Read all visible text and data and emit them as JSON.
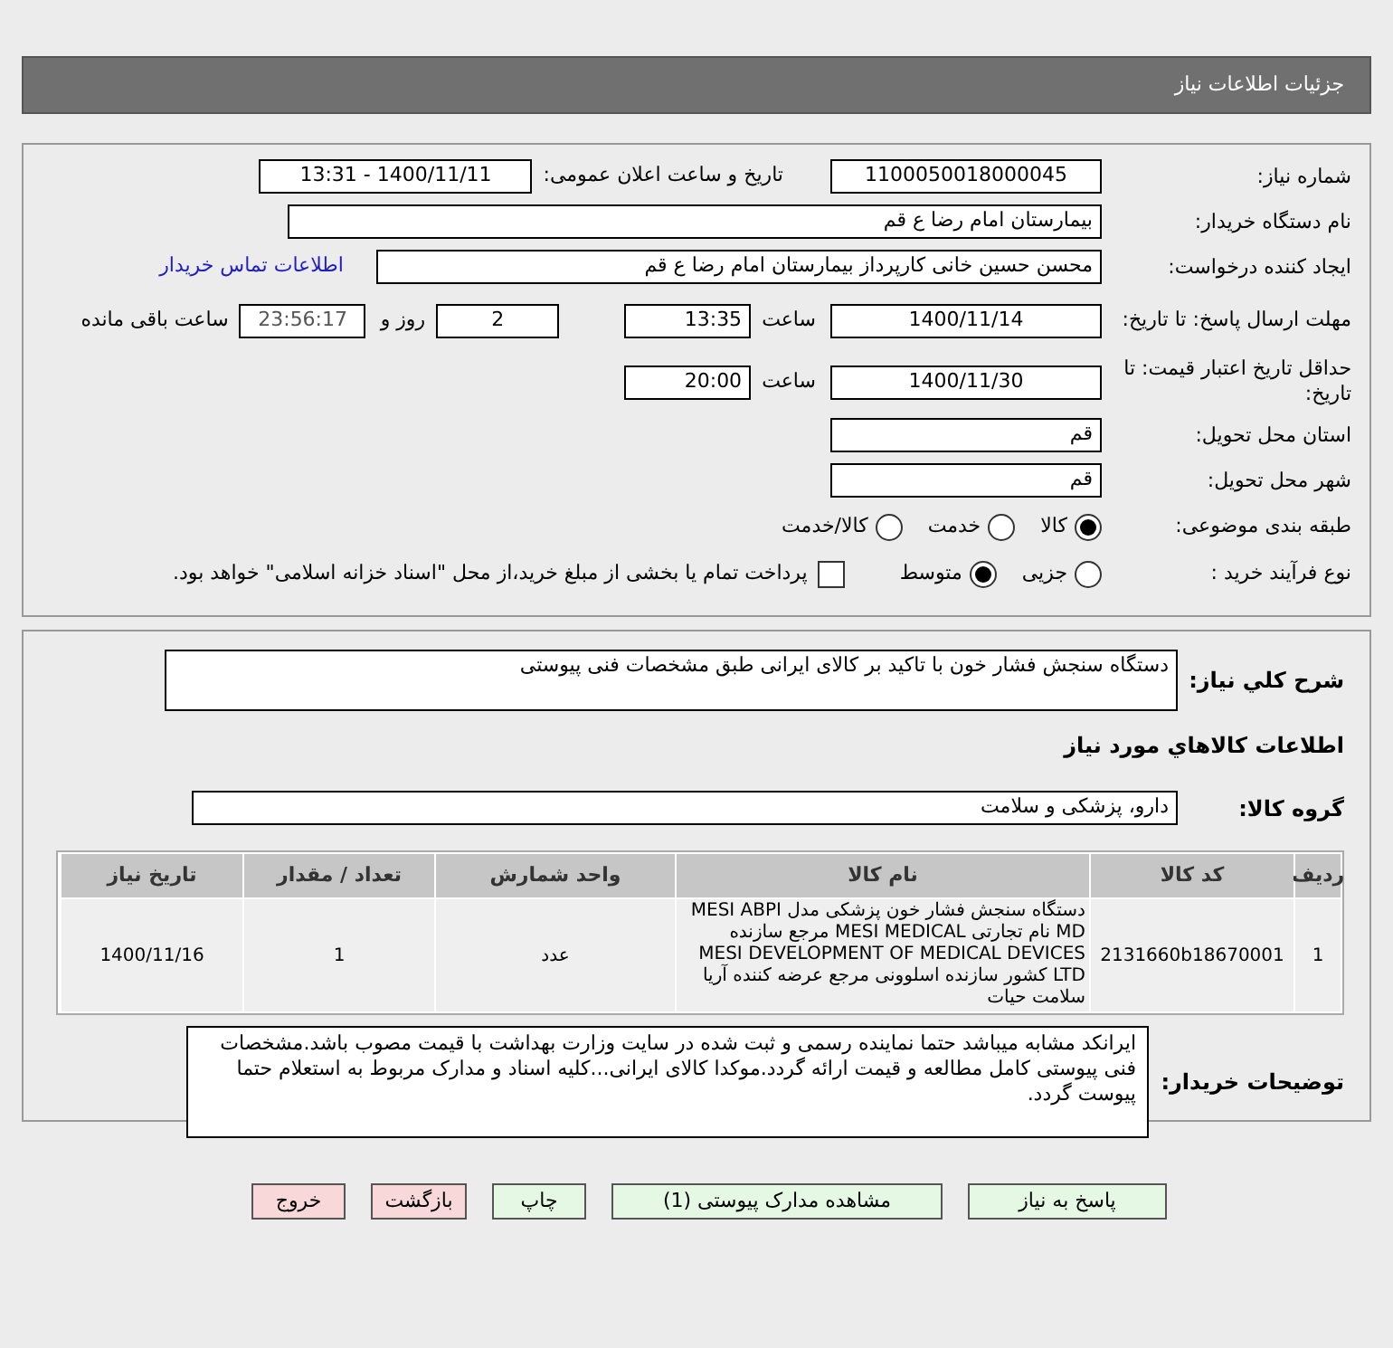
{
  "header": {
    "title": "جزئیات اطلاعات نیاز"
  },
  "details": {
    "need_number": {
      "label": "شماره نیاز:",
      "value": "1100050018000045"
    },
    "announce": {
      "label": "تاریخ و ساعت اعلان عمومی:",
      "value": "1400/11/11 - 13:31"
    },
    "buyer_org": {
      "label": "نام دستگاه خریدار:",
      "value": "بیمارستان امام رضا ع  قم"
    },
    "requester": {
      "label": "ایجاد کننده درخواست:",
      "value": "محسن حسین خانی کارپرداز بیمارستان امام رضا ع  قم",
      "link": "اطلاعات تماس خریدار"
    },
    "reply_deadline": {
      "label": "مهلت ارسال پاسخ: تا تاریخ:",
      "date": "1400/11/14",
      "time_label": "ساعت",
      "time": "13:35",
      "days": "2",
      "days_label": "روز و",
      "remaining": "23:56:17",
      "remaining_label": "ساعت باقی مانده"
    },
    "price_validity": {
      "label": "حداقل تاریخ اعتبار قیمت: تا تاریخ:",
      "date": "1400/11/30",
      "time_label": "ساعت",
      "time": "20:00"
    },
    "province": {
      "label": "استان محل تحویل:",
      "value": "قم"
    },
    "city": {
      "label": "شهر محل تحویل:",
      "value": "قم"
    },
    "category": {
      "label": "طبقه بندی موضوعی:",
      "options": [
        {
          "label": "کالا",
          "selected": true
        },
        {
          "label": "خدمت",
          "selected": false
        },
        {
          "label": "کالا/خدمت",
          "selected": false
        }
      ]
    },
    "process": {
      "label": "نوع فرآیند خرید :",
      "options": [
        {
          "label": "جزیی",
          "selected": false
        },
        {
          "label": "متوسط",
          "selected": true
        }
      ],
      "payment": {
        "label": "پرداخت تمام یا بخشی از مبلغ خرید،از محل \"اسناد خزانه اسلامی\" خواهد بود.",
        "checked": false
      }
    }
  },
  "goods": {
    "description": {
      "label": "شرح کلي نياز:",
      "value": "دستگاه سنجش فشار خون با تاکید بر کالای ایرانی طبق مشخصات فنی پیوستی"
    },
    "section_title": "اطلاعات کالاهاي مورد نياز",
    "group": {
      "label": "گروه کالا:",
      "value": "دارو، پزشکی و سلامت"
    },
    "table": {
      "columns": [
        "ردیف",
        "کد کالا",
        "نام کالا",
        "واحد شمارش",
        "تعداد / مقدار",
        "تاریخ نیاز"
      ],
      "rows": [
        [
          "1",
          "2131660b18670001",
          "دستگاه سنجش فشار خون پزشکی مدل MESI ABPI MD نام تجارتی MESI MEDICAL مرجع سازنده MESI DEVELOPMENT OF MEDICAL DEVICES LTD کشور سازنده اسلوونی مرجع عرضه کننده آریا سلامت حیات",
          "عدد",
          "1",
          "1400/11/16"
        ]
      ]
    },
    "notes": {
      "label": "توضیحات خریدار:",
      "value": "ایرانکد مشابه میباشد حتما نماینده رسمی و ثبت شده در سایت وزارت بهداشت با قیمت مصوب باشد.مشخصات فنی پیوستی کامل مطالعه و قیمت ارائه گردد.موکدا کالای ایرانی...کلیه اسناد و مدارک مربوط به استعلام حتما پیوست گردد."
    }
  },
  "buttons": [
    {
      "label": "پاسخ به نیاز",
      "kind": "normal"
    },
    {
      "label": "مشاهده مدارک پیوستی (1)",
      "kind": "normal"
    },
    {
      "label": "چاپ",
      "kind": "normal"
    },
    {
      "label": "بازگشت",
      "kind": "exit"
    },
    {
      "label": "خروج",
      "kind": "exit"
    }
  ]
}
